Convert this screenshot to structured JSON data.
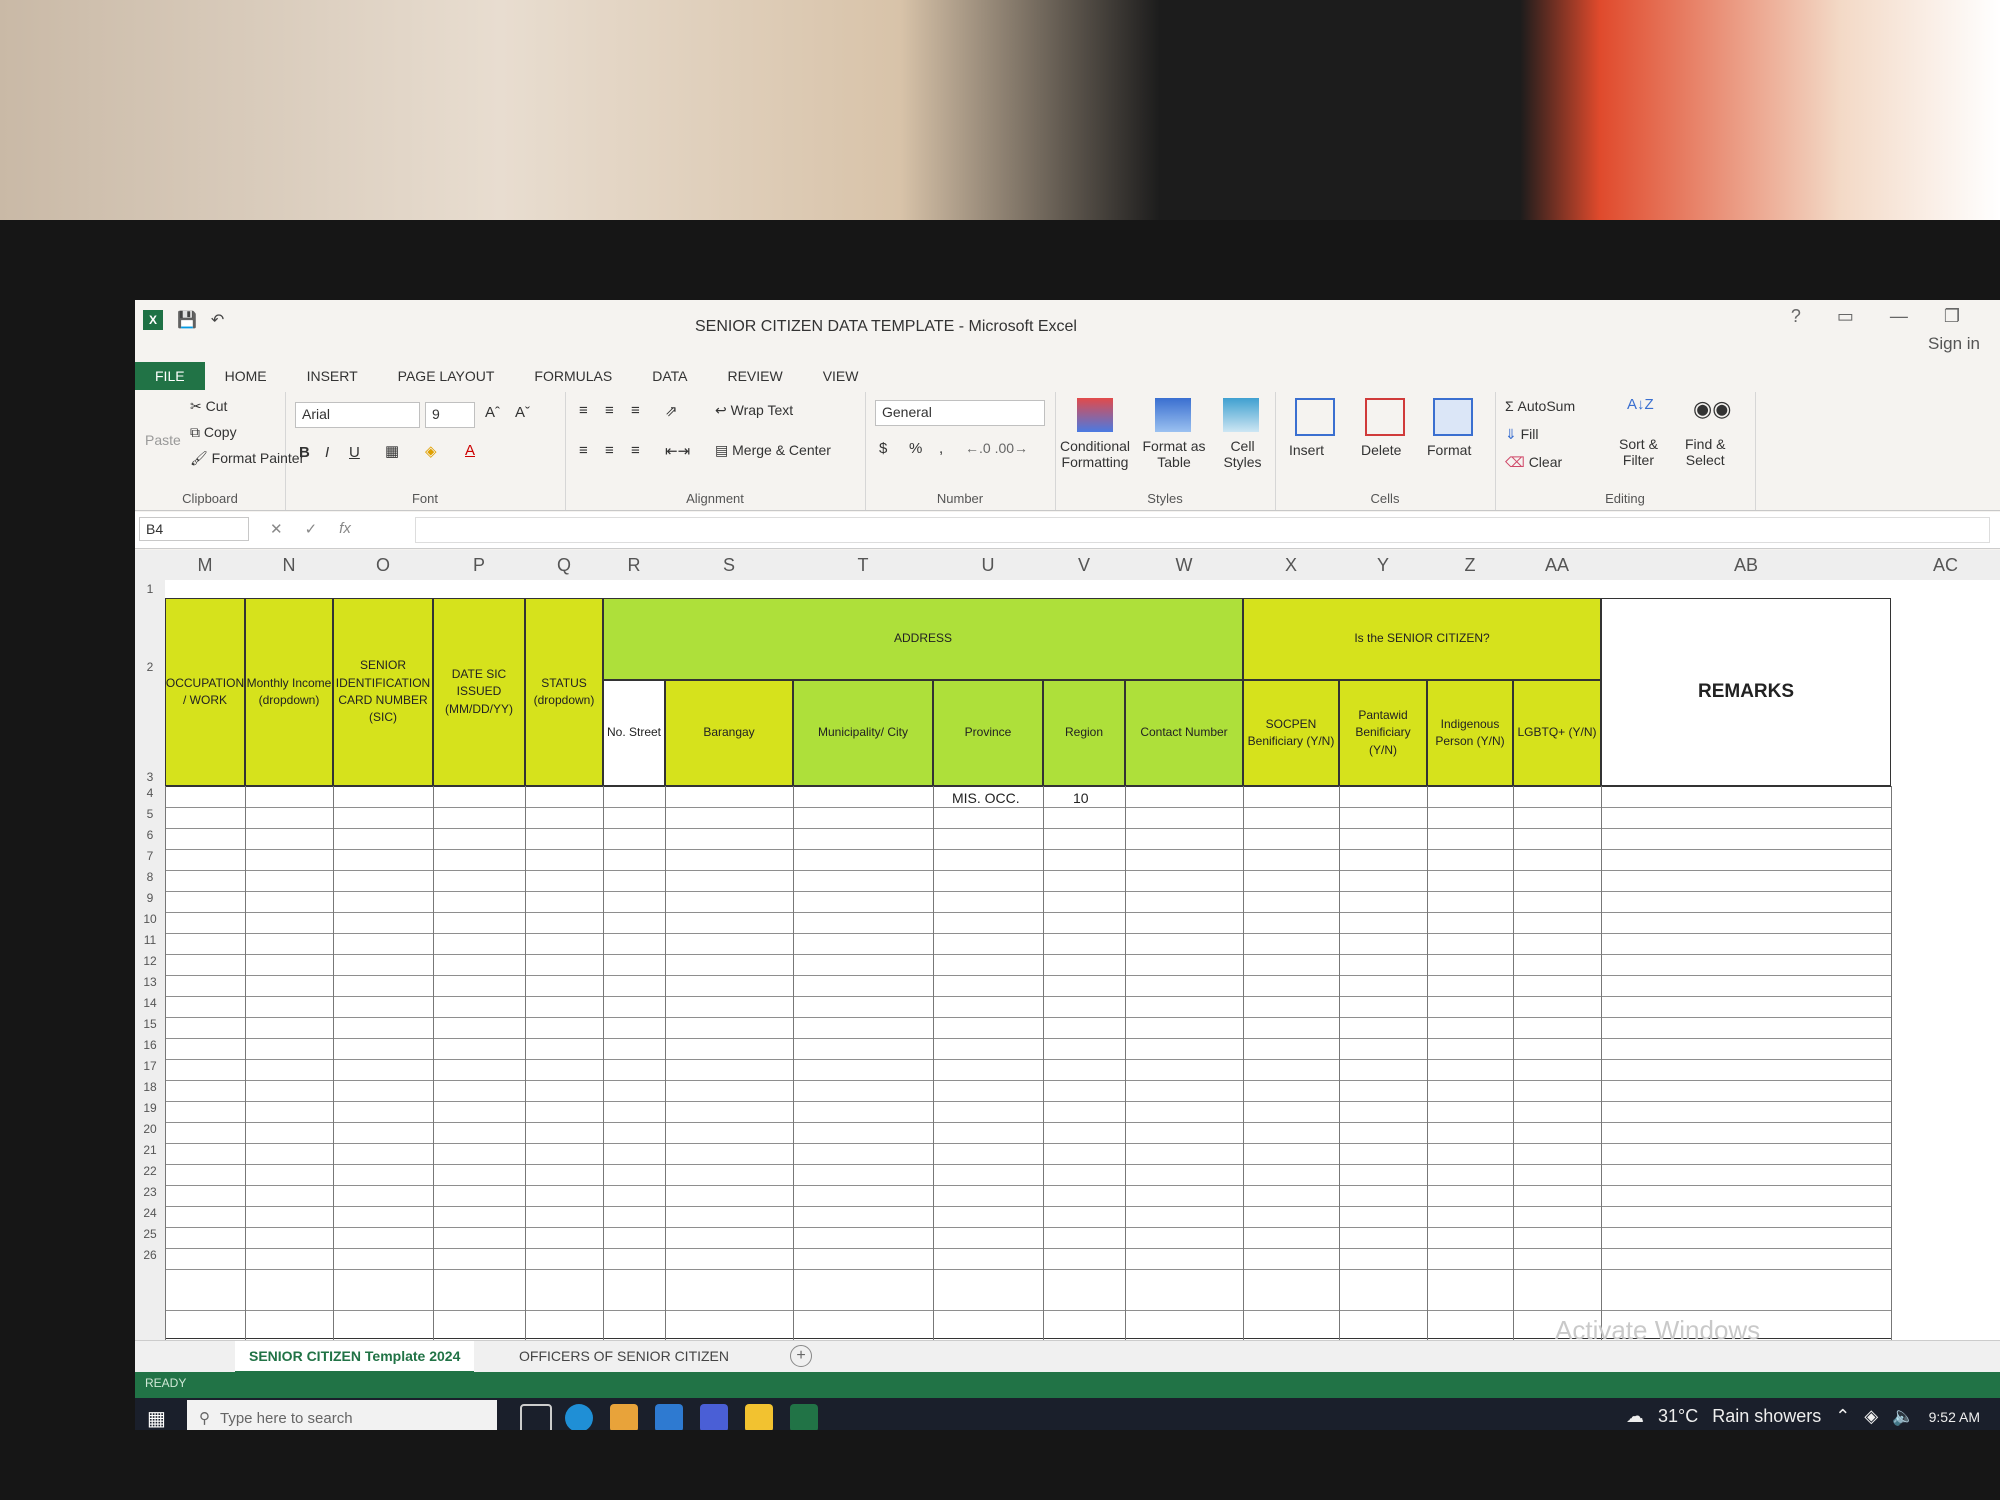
{
  "window": {
    "title": "SENIOR CITIZEN DATA TEMPLATE - Microsoft Excel",
    "help": "?",
    "sign_in": "Sign in",
    "app_icon": "X"
  },
  "tabs": [
    "FILE",
    "HOME",
    "INSERT",
    "PAGE LAYOUT",
    "FORMULAS",
    "DATA",
    "REVIEW",
    "VIEW"
  ],
  "ribbon": {
    "clipboard": {
      "paste": "Paste",
      "cut": "Cut",
      "copy": "Copy",
      "format_painter": "Format Painter",
      "label": "Clipboard"
    },
    "font": {
      "name": "Arial",
      "size": "9",
      "grow": "Aˆ",
      "shrink": "Aˇ",
      "bold": "B",
      "italic": "I",
      "underline": "U",
      "font_color": "A",
      "label": "Font"
    },
    "alignment": {
      "wrap_text": "Wrap Text",
      "merge_center": "Merge & Center",
      "label": "Alignment"
    },
    "number": {
      "format": "General",
      "currency": "$",
      "percent": "%",
      "comma": ",",
      "label": "Number"
    },
    "styles": {
      "conditional": "Conditional",
      "formatting": "Formatting",
      "format_as": "Format as",
      "table": "Table",
      "cell": "Cell",
      "cell_styles": "Styles",
      "label": "Styles"
    },
    "cells": {
      "insert": "Insert",
      "delete": "Delete",
      "format": "Format",
      "label": "Cells"
    },
    "editing": {
      "autosum": "AutoSum",
      "fill": "Fill",
      "clear": "Clear",
      "sort": "Sort &",
      "filter": "Filter",
      "find": "Find &",
      "select": "Select",
      "label": "Editing"
    }
  },
  "formula_bar": {
    "name_box": "B4",
    "fx": "fx",
    "value": ""
  },
  "columns": [
    "M",
    "N",
    "O",
    "P",
    "Q",
    "R",
    "S",
    "T",
    "U",
    "V",
    "W",
    "X",
    "Y",
    "Z",
    "AA",
    "AB",
    "AC"
  ],
  "rows": [
    "1",
    "2",
    "3",
    "4",
    "5",
    "6",
    "7",
    "8",
    "9",
    "10",
    "11",
    "12",
    "13",
    "14",
    "15",
    "16",
    "17",
    "18",
    "19",
    "20",
    "21",
    "22",
    "23",
    "24",
    "25",
    "26"
  ],
  "headers": {
    "occupation": "OCCUPATION / WORK",
    "income": "Monthly Income (dropdown)",
    "sic_number": "SENIOR IDENTIFICATION CARD NUMBER (SIC)",
    "date_sic": "DATE SIC ISSUED (MM/DD/YY)",
    "status": "STATUS (dropdown)",
    "address": "ADDRESS",
    "no_street": "No. Street",
    "barangay": "Barangay",
    "municipality": "Municipality/ City",
    "province": "Province",
    "region": "Region",
    "contact": "Contact Number",
    "is_senior": "Is the SENIOR CITIZEN?",
    "socpen": "SOCPEN Benificiary (Y/N)",
    "pantawid": "Pantawid Benificiary (Y/N)",
    "indigenous": "Indigenous Person (Y/N)",
    "lgbtq": "LGBTQ+ (Y/N)",
    "remarks": "REMARKS"
  },
  "cells": {
    "province_row4": "MIS. OCC.",
    "region_row4": "10"
  },
  "sheets": [
    "SENIOR CITIZEN Template 2024",
    "OFFICERS OF SENIOR CITIZEN"
  ],
  "add_sheet": "+",
  "status": "READY",
  "watermark": "Activate Windows",
  "taskbar": {
    "search_placeholder": "Type here to search",
    "temp": "31°C",
    "weather": "Rain showers",
    "time": "9:52 AM"
  },
  "colors": {
    "header_yellow": "#d6e21c",
    "header_green": "#aee03a",
    "excel_green": "#217346"
  }
}
